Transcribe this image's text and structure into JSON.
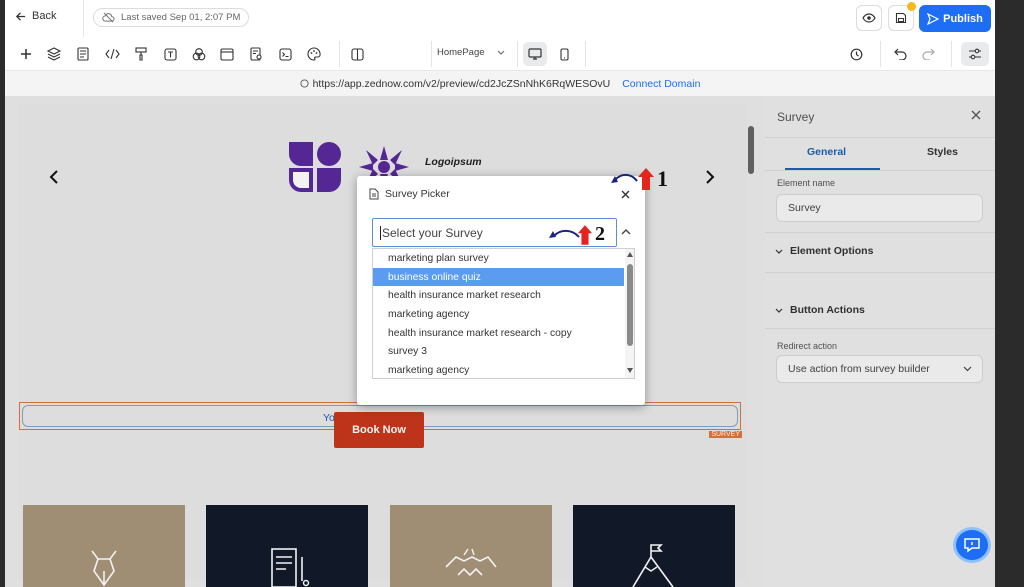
{
  "header": {
    "back_label": "Back",
    "saved_status": "Last saved Sep 01, 2:07 PM",
    "publish_label": "Publish"
  },
  "toolbar": {
    "page_select": "HomePage"
  },
  "preview": {
    "url": "https://app.zednow.com/v2/preview/cd2JcZSnNhK6RqWESOvU",
    "connect_domain": "Connect Domain",
    "brand_name": "Logoipsum",
    "survey_placeholder_text": "You do not",
    "survey_tag": "SURVEY",
    "book_now": "Book Now",
    "card_colors": [
      "#a8967a",
      "#121a2b",
      "#a8967a",
      "#121a2b"
    ]
  },
  "right_panel": {
    "title": "Survey",
    "tabs": [
      "General",
      "Styles"
    ],
    "element_name_label": "Element name",
    "element_name_value": "Survey",
    "section_element_options": "Element Options",
    "section_button_actions": "Button Actions",
    "redirect_label": "Redirect action",
    "redirect_value": "Use action from survey builder"
  },
  "modal": {
    "title": "Survey Picker",
    "select_placeholder": "Select your Survey",
    "options": [
      "marketing plan survey",
      "business online quiz",
      "health insurance market research",
      "marketing agency",
      "health insurance market research - copy",
      "survey 3",
      "marketing agency"
    ],
    "selected_index": 1
  },
  "annotations": {
    "step_1": "1",
    "step_2": "2"
  },
  "colors": {
    "accent": "#1d6ef5",
    "survey_outline": "#e0763a",
    "book_now_bg": "#c8371c",
    "logo_purple": "#5a2a9c"
  }
}
